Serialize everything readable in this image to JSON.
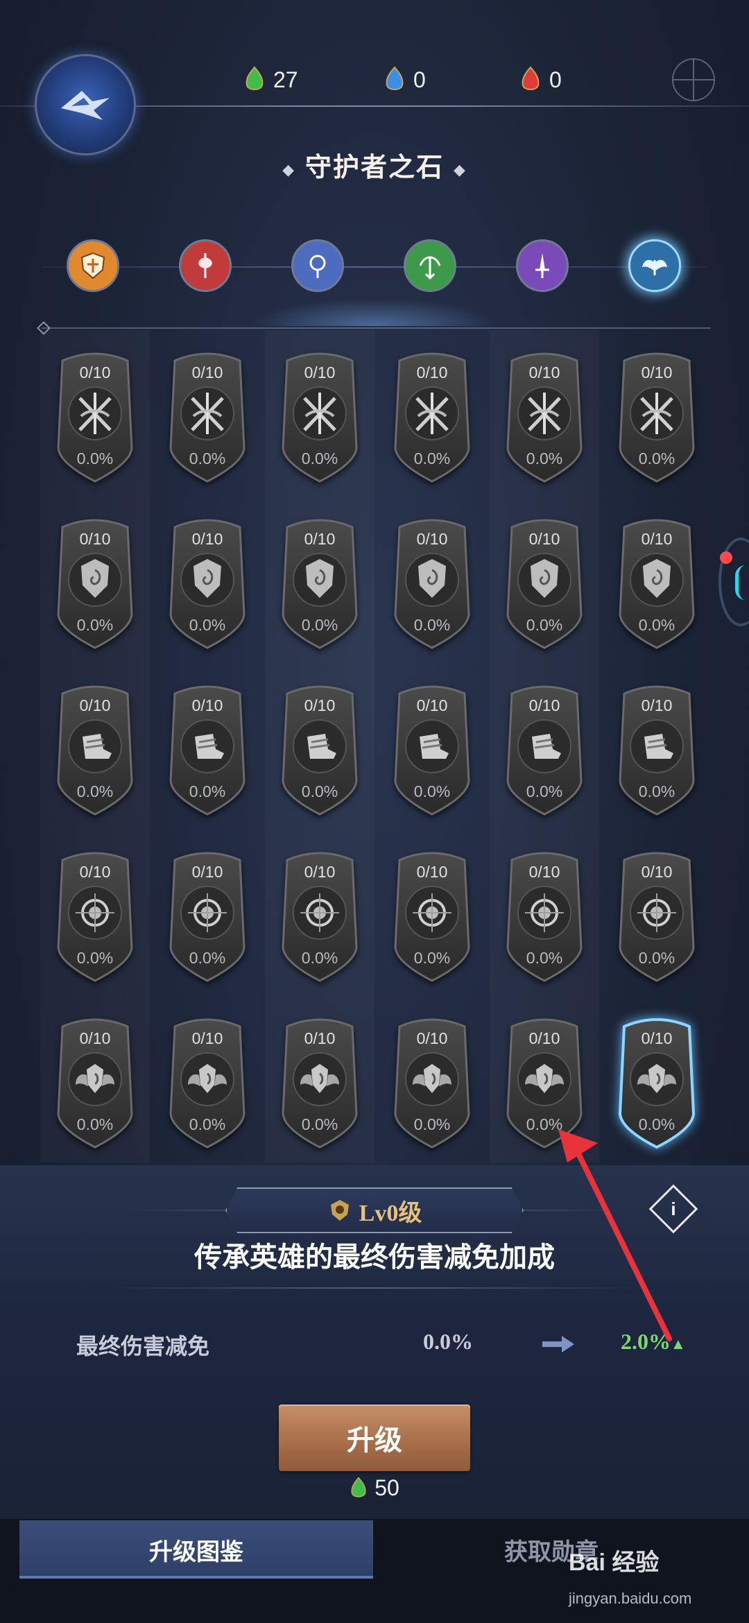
{
  "currencies": [
    {
      "name": "green-gem",
      "value": "27",
      "color": "#3fbf4a"
    },
    {
      "name": "blue-gem",
      "value": "0",
      "color": "#3a8fe8"
    },
    {
      "name": "red-gem",
      "value": "0",
      "color": "#e03b3b"
    }
  ],
  "title": "守护者之石",
  "categories": [
    {
      "name": "shield",
      "color": "#e0892f"
    },
    {
      "name": "axe",
      "color": "#c23b3b"
    },
    {
      "name": "orb",
      "color": "#4d6bbf"
    },
    {
      "name": "bow",
      "color": "#3c9a4a"
    },
    {
      "name": "dagger",
      "color": "#7a4bb8"
    },
    {
      "name": "wings",
      "color": "#2f6fa8",
      "active": true
    }
  ],
  "badges": {
    "level": "0/10",
    "percent": "0.0%",
    "rows": [
      {
        "icon": "crossed-weapons-icon"
      },
      {
        "icon": "shield-crest-icon"
      },
      {
        "icon": "boots-icon"
      },
      {
        "icon": "compass-icon"
      },
      {
        "icon": "winged-crest-icon"
      }
    ],
    "selected": {
      "row": 4,
      "col": 5
    }
  },
  "detail": {
    "level_label": "Lv0级",
    "description": "传承英雄的最终伤害减免加成",
    "info_label": "i",
    "stat_name": "最终伤害减免",
    "stat_current": "0.0%",
    "stat_next": "2.0%"
  },
  "upgrade": {
    "label": "升级",
    "cost": "50"
  },
  "tabs": {
    "active": "升级图鉴",
    "other": "获取勋章"
  },
  "watermark": {
    "text": "Bai 经验",
    "sub": "jingyan.baidu.com"
  }
}
